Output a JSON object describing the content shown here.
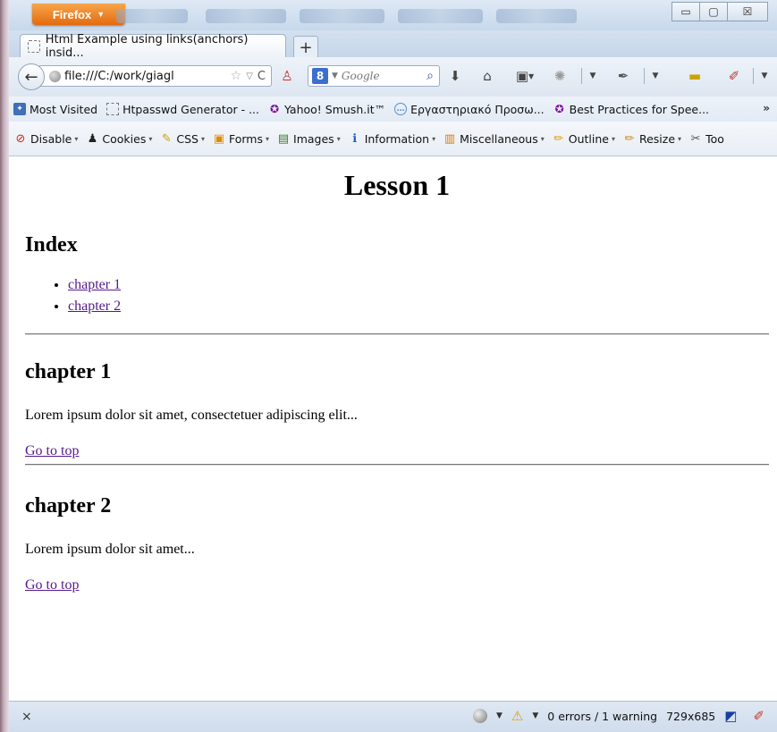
{
  "browser": {
    "menu_button_label": "Firefox",
    "window_controls": {
      "minimize": "▭",
      "maximize": "▢",
      "close": "☒"
    },
    "tab": {
      "title": "Html Example using links(anchors) insid..."
    },
    "new_tab_label": "+",
    "url": "file:///C:/work/giagl",
    "search": {
      "engine_badge": "8",
      "placeholder": "Google"
    }
  },
  "bookmarks": [
    {
      "label": "Most Visited",
      "icon": "most-visited-icon"
    },
    {
      "label": "Htpasswd Generator - ...",
      "icon": "page-icon"
    },
    {
      "label": "Yahoo! Smush.it™",
      "icon": "yahoo-icon"
    },
    {
      "label": "Εργαστηριακό Προσω...",
      "icon": "chat-icon"
    },
    {
      "label": "Best Practices for Spee...",
      "icon": "yahoo-icon"
    }
  ],
  "bookmarks_overflow": "»",
  "devtoolbar": [
    {
      "label": "Disable",
      "icon": "disable-icon",
      "glyph": "⊘",
      "color": "#d8261b"
    },
    {
      "label": "Cookies",
      "icon": "cookies-icon",
      "glyph": "♟",
      "color": "#222222"
    },
    {
      "label": "CSS",
      "icon": "css-icon",
      "glyph": "✎",
      "color": "#c9a400"
    },
    {
      "label": "Forms",
      "icon": "forms-icon",
      "glyph": "▣",
      "color": "#e08a00"
    },
    {
      "label": "Images",
      "icon": "images-icon",
      "glyph": "▤",
      "color": "#3a7a2a"
    },
    {
      "label": "Information",
      "icon": "information-icon",
      "glyph": "ℹ",
      "color": "#1f5fbf"
    },
    {
      "label": "Miscellaneous",
      "icon": "miscellaneous-icon",
      "glyph": "▥",
      "color": "#e07b00"
    },
    {
      "label": "Outline",
      "icon": "outline-icon",
      "glyph": "✏",
      "color": "#e0a000"
    },
    {
      "label": "Resize",
      "icon": "resize-icon",
      "glyph": "✏",
      "color": "#d08a20"
    },
    {
      "label": "Too",
      "icon": "tools-icon",
      "glyph": "✂",
      "color": "#555555"
    }
  ],
  "page": {
    "title": "Lesson 1",
    "index_heading": "Index",
    "index_links": [
      "chapter 1",
      "chapter 2"
    ],
    "chapters": [
      {
        "heading": "chapter 1",
        "text": "Lorem ipsum dolor sit amet, consectetuer adipiscing elit...",
        "top_link": "Go to top"
      },
      {
        "heading": "chapter 2",
        "text": "Lorem ipsum dolor sit amet...",
        "top_link": "Go to top"
      }
    ]
  },
  "statusbar": {
    "close": "×",
    "errors": "0 errors / 1 warning",
    "size": "729x685"
  }
}
